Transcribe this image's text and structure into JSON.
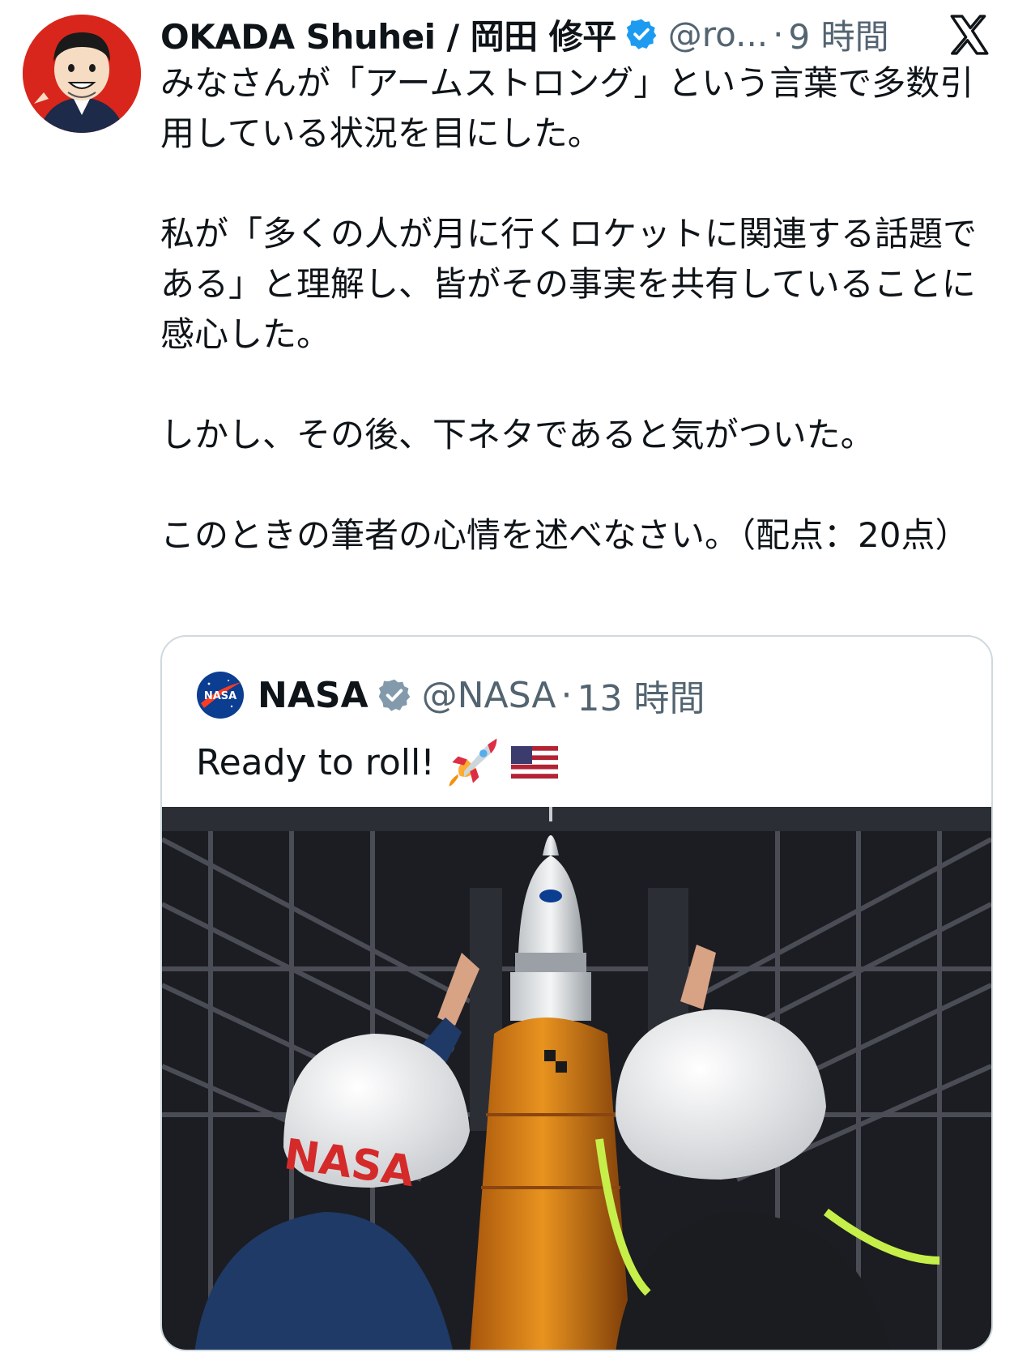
{
  "tweet": {
    "author_name": "OKADA Shuhei / 岡田 修平",
    "handle": "@ro...",
    "separator": "·",
    "time": "9 時間",
    "paragraphs": [
      "みなさんが「アームストロング」という言葉で多数引用している状況を目にした。",
      "私が「多くの人が月に行くロケットに関連する話題である」と理解し、皆がその事実を共有していることに感心した。",
      "しかし、その後、下ネタであると気がついた。",
      "このときの筆者の心情を述べなさい。（配点：20点）"
    ]
  },
  "quoted": {
    "author_name": "NASA",
    "handle": "@NASA",
    "separator": "·",
    "time": "13 時間",
    "text": "Ready to roll!",
    "logo_text": "NASA",
    "helmet_text": "NASA"
  },
  "icons": {
    "verified": "verified-badge-icon",
    "platform": "x-logo-icon",
    "rocket": "rocket-emoji-icon",
    "flag": "us-flag-emoji-icon"
  },
  "colors": {
    "verified_blue": "#1d9bf0",
    "secondary_text": "#536471",
    "border": "#cfd9de",
    "rocket_orange": "#e8931f"
  }
}
